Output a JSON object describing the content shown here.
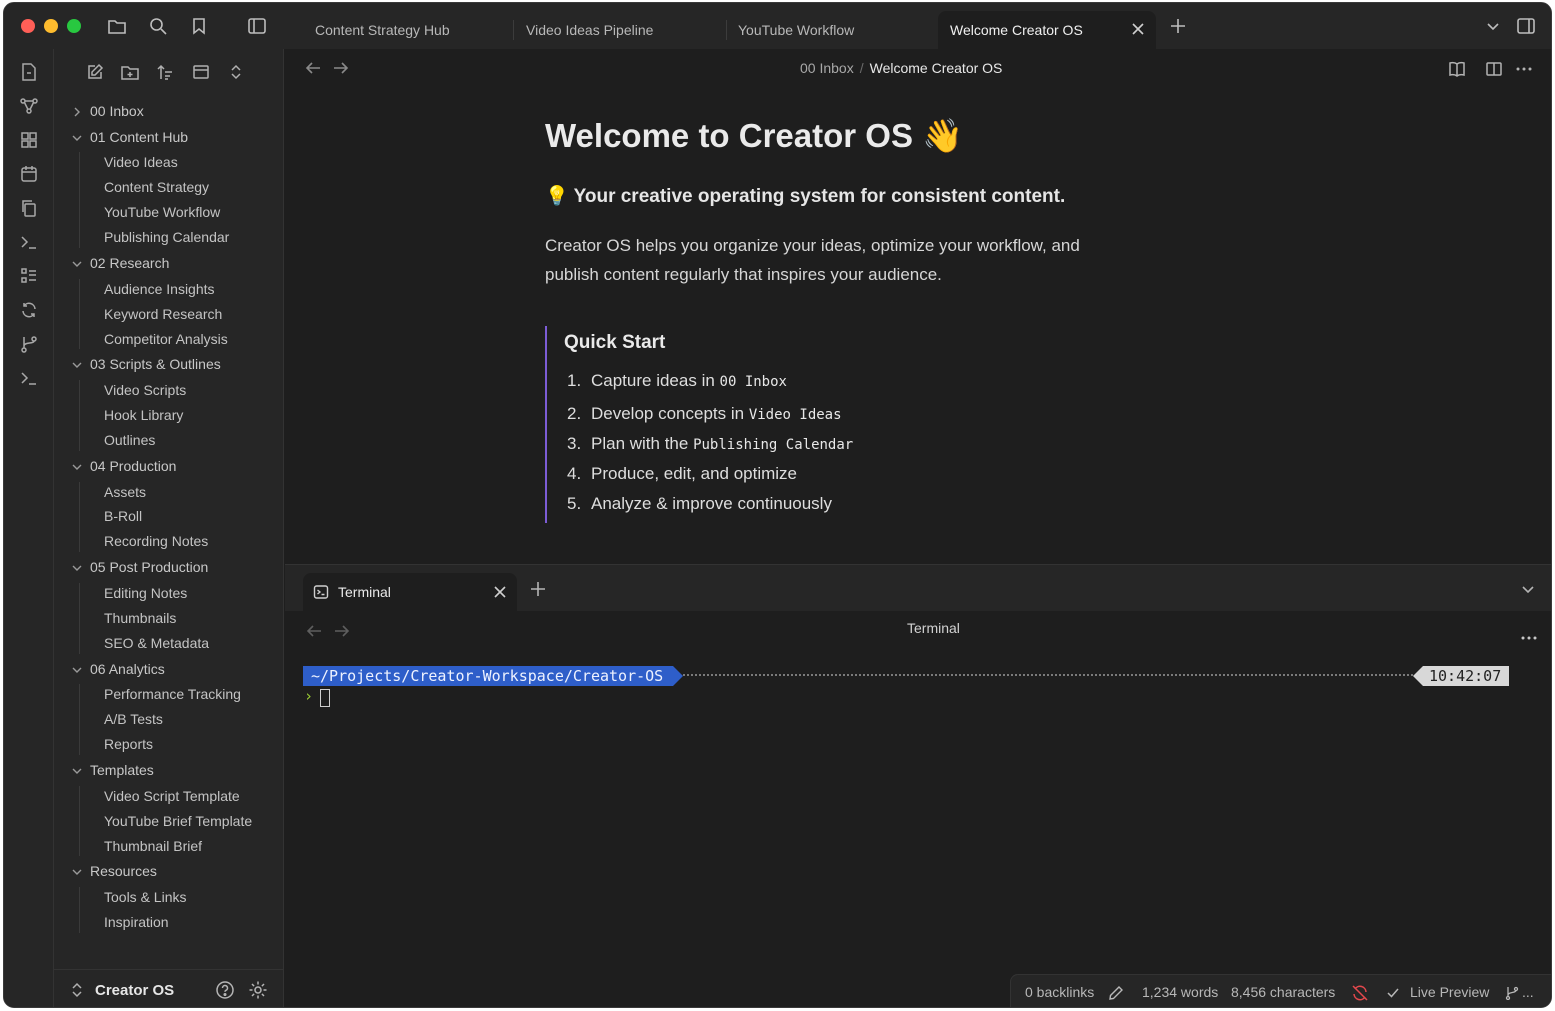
{
  "titlebar": {
    "tabs": [
      {
        "label": "Content Strategy Hub"
      },
      {
        "label": "Video Ideas Pipeline"
      },
      {
        "label": "YouTube Workflow"
      },
      {
        "label": "Welcome Creator OS",
        "active": true
      }
    ]
  },
  "sidebar": {
    "folders": [
      {
        "label": "00 Inbox",
        "expanded": false,
        "files": []
      },
      {
        "label": "01 Content Hub",
        "expanded": true,
        "files": [
          "Video Ideas",
          "Content Strategy",
          "YouTube Workflow",
          "Publishing Calendar"
        ]
      },
      {
        "label": "02 Research",
        "expanded": true,
        "files": [
          "Audience Insights",
          "Keyword Research",
          "Competitor Analysis"
        ]
      },
      {
        "label": "03 Scripts & Outlines",
        "expanded": true,
        "files": [
          "Video Scripts",
          "Hook Library",
          "Outlines"
        ]
      },
      {
        "label": "04 Production",
        "expanded": true,
        "files": [
          "Assets",
          "B-Roll",
          "Recording Notes"
        ]
      },
      {
        "label": "05 Post Production",
        "expanded": true,
        "files": [
          "Editing Notes",
          "Thumbnails",
          "SEO & Metadata"
        ]
      },
      {
        "label": "06 Analytics",
        "expanded": true,
        "files": [
          "Performance Tracking",
          "A/B Tests",
          "Reports"
        ]
      },
      {
        "label": "Templates",
        "expanded": true,
        "files": [
          "Video Script Template",
          "YouTube Brief Template",
          "Thumbnail Brief"
        ]
      },
      {
        "label": "Resources",
        "expanded": true,
        "files": [
          "Tools & Links",
          "Inspiration"
        ]
      }
    ],
    "vault_name": "Creator OS"
  },
  "editor": {
    "breadcrumb": {
      "parent": "00 Inbox",
      "separator": "/",
      "current": "Welcome Creator OS"
    },
    "title": "Welcome to Creator OS 👋",
    "subtitle": "💡 Your creative operating system for consistent content.",
    "body": "Creator OS helps you organize your ideas, optimize your workflow, and publish content regularly that inspires your audience.",
    "callout": {
      "title": "Quick Start",
      "items": [
        {
          "num": "1.",
          "text": "Capture ideas in ",
          "code": "00 Inbox"
        },
        {
          "num": "2.",
          "text": "Develop concepts in ",
          "code": "Video Ideas"
        },
        {
          "num": "3.",
          "text": "Plan with the ",
          "code": "Publishing Calendar"
        },
        {
          "num": "4.",
          "text": "Produce, edit, and optimize",
          "code": ""
        },
        {
          "num": "5.",
          "text": "Analyze & improve continuously",
          "code": ""
        }
      ]
    }
  },
  "terminal": {
    "tab_label": "Terminal",
    "header_title": "Terminal",
    "path": "~/Projects/Creator-Workspace/Creator-OS",
    "time": "10:42:07",
    "prompt": "›"
  },
  "statusbar": {
    "backlinks": "0 backlinks",
    "words": "1,234 words",
    "characters": "8,456 characters",
    "mode": "Live Preview",
    "more": "..."
  },
  "colors": {
    "accent": "#7c5cd6",
    "terminal_path_bg": "#2e5ec9",
    "prompt": "#9acd32",
    "sync_error": "#e5484d"
  }
}
